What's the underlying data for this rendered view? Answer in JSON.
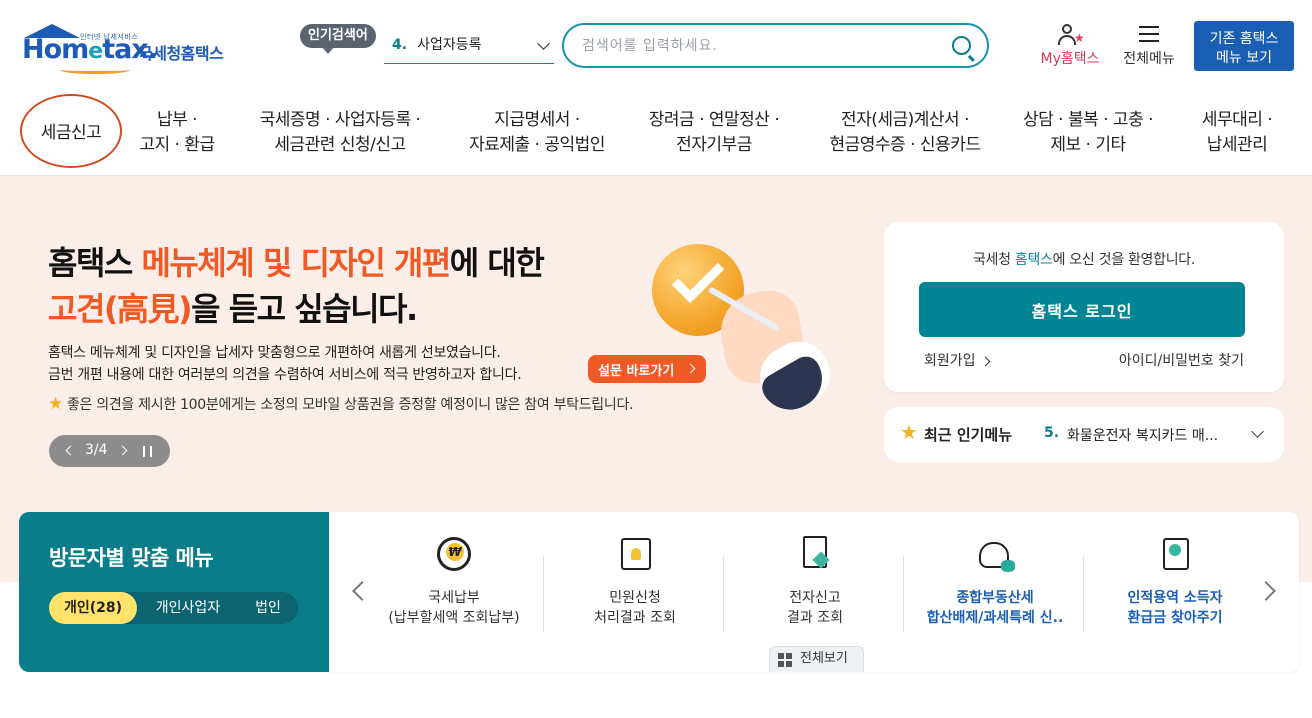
{
  "header": {
    "logo_tagline": "인터넷 납세서비스",
    "logo_word_a": "Hom",
    "logo_word_e": "e",
    "logo_word_b": "tax.",
    "logo_ko": "국세청홈택스",
    "popular_badge": "인기검색어",
    "popular_rank": "4.",
    "popular_item": "사업자등록",
    "search_placeholder": "검색어를 입력하세요.",
    "my_hometax": "My홈택스",
    "all_menu": "전체메뉴",
    "legacy_button_line1": "기존 홈택스",
    "legacy_button_line2": "메뉴 보기"
  },
  "gnb": [
    {
      "label": "세금신고"
    },
    {
      "label": "납부 ·\n고지 · 환급"
    },
    {
      "label": "국세증명 · 사업자등록 ·\n세금관련 신청/신고"
    },
    {
      "label": "지급명세서 ·\n자료제출 · 공익법인"
    },
    {
      "label": "장려금 · 연말정산 ·\n전자기부금"
    },
    {
      "label": "전자(세금)계산서 ·\n현금영수증 · 신용카드"
    },
    {
      "label": "상담 · 불복 · 고충 ·\n제보 · 기타"
    },
    {
      "label": "세무대리 ·\n납세관리"
    }
  ],
  "hero": {
    "t1_a": "홈택스 ",
    "t1_hl": "메뉴체계 및 디자인 개편",
    "t1_b": "에 대한",
    "t2_hl": "고견(高見)",
    "t2_b": "을 듣고 싶습니다.",
    "desc1": "홈택스 메뉴체계 및 디자인을 납세자 맞춤형으로 개편하여 새롭게 선보였습니다.",
    "desc2": "금번 개편 내용에 대한 여러분의 의견을 수렴하여 서비스에 적극 반영하고자 합니다.",
    "survey_button": "설문 바로가기",
    "note": "좋은 의견을 제시한 100분에게는 소정의 모바일 상품권을 증정할 예정이니 많은 참여 부탁드립니다.",
    "pager": "3/4"
  },
  "login": {
    "welcome_a": "국세청 ",
    "welcome_brand": "홈택스",
    "welcome_b": "에 오신 것을 환영합니다.",
    "login_button": "홈택스 로그인",
    "join": "회원가입",
    "find": "아이디/비밀번호 찾기"
  },
  "recent": {
    "title": "최근 인기메뉴",
    "rank": "5.",
    "item": "화물운전자 복지카드 매..."
  },
  "visitor": {
    "title": "방문자별 맞춤 메뉴",
    "tabs": [
      "개인(28)",
      "개인사업자",
      "법인"
    ]
  },
  "quick": {
    "items": [
      {
        "label": "국세납부\n(납부할세액 조회납부)"
      },
      {
        "label": "민원신청\n처리결과 조회"
      },
      {
        "label": "전자신고\n결과 조회"
      },
      {
        "label": "종합부동산세\n합산배제/과세특례 신.."
      },
      {
        "label": "인적용역 소득자\n환급금 찾아주기"
      }
    ],
    "full_view": "전체보기"
  },
  "colors": {
    "brand_blue": "#1d5bb6",
    "teal": "#018595",
    "accent_orange": "#ef5a24",
    "hero_bg": "#fbeee9"
  }
}
